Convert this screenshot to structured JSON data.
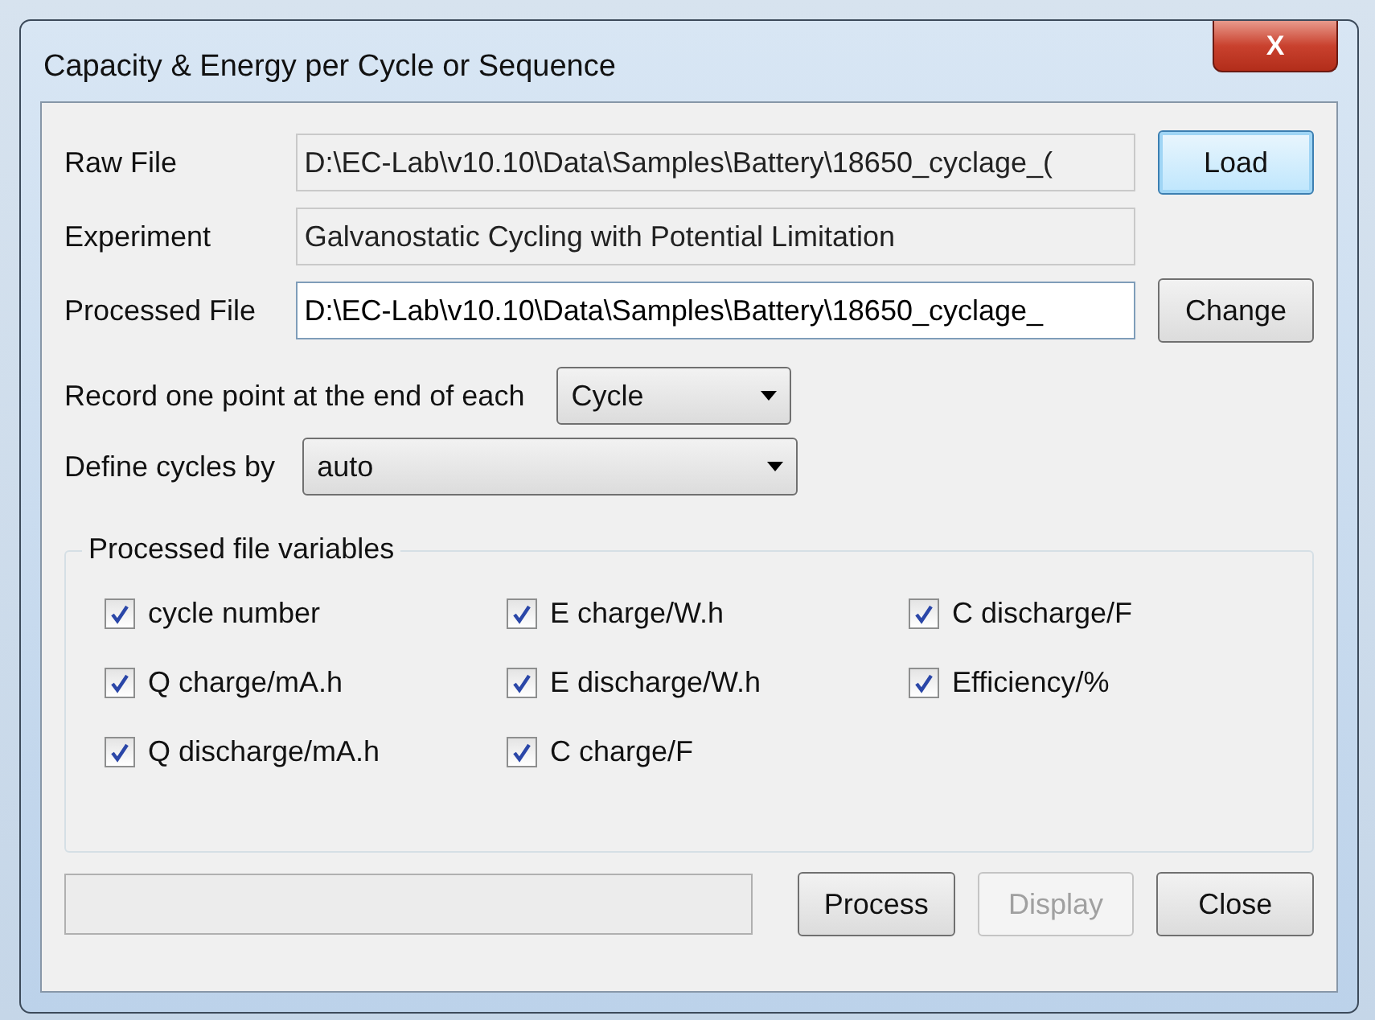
{
  "window": {
    "title": "Capacity & Energy per Cycle or Sequence",
    "close_glyph": "X"
  },
  "fields": [
    {
      "label": "Raw File",
      "value": "D:\\EC-Lab\\v10.10\\Data\\Samples\\Battery\\18650_cyclage_(",
      "editable": false,
      "button": "Load",
      "focused": true
    },
    {
      "label": "Experiment",
      "value": "Galvanostatic Cycling with Potential Limitation",
      "editable": false
    },
    {
      "label": "Processed File",
      "value": "D:\\EC-Lab\\v10.10\\Data\\Samples\\Battery\\18650_cyclage_",
      "editable": true,
      "button": "Change",
      "focused": false
    }
  ],
  "record": {
    "label": "Record one point at the end of each",
    "value": "Cycle"
  },
  "define": {
    "label": "Define cycles by",
    "value": "auto"
  },
  "variables": {
    "title": "Processed file variables",
    "items": [
      {
        "label": "cycle number",
        "checked": true
      },
      {
        "label": "E charge/W.h",
        "checked": true
      },
      {
        "label": "C discharge/F",
        "checked": true
      },
      {
        "label": "Q charge/mA.h",
        "checked": true
      },
      {
        "label": "E discharge/W.h",
        "checked": true
      },
      {
        "label": "Efficiency/%",
        "checked": true
      },
      {
        "label": "Q discharge/mA.h",
        "checked": true
      },
      {
        "label": "C charge/F",
        "checked": true
      }
    ]
  },
  "progress": {
    "level": 0
  },
  "buttons": [
    {
      "label": "Process",
      "disabled": false
    },
    {
      "label": "Display",
      "disabled": true
    },
    {
      "label": "Close",
      "disabled": false
    }
  ]
}
